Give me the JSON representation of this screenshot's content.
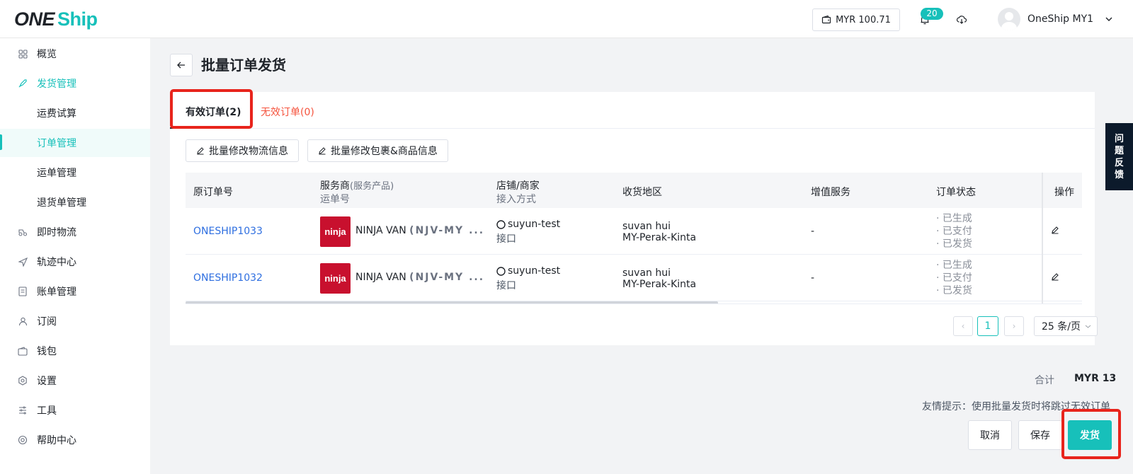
{
  "header": {
    "logo_one": "ONE",
    "logo_ship": "Ship",
    "balance": "MYR 100.71",
    "notification_count": "20",
    "user_name": "OneShip MY1"
  },
  "sidebar": {
    "items": [
      {
        "label": "概览",
        "icon": "grid-icon"
      },
      {
        "label": "发货管理",
        "icon": "rocket-icon"
      },
      {
        "label": "运费试算",
        "icon": ""
      },
      {
        "label": "订单管理",
        "icon": ""
      },
      {
        "label": "运单管理",
        "icon": ""
      },
      {
        "label": "退货单管理",
        "icon": ""
      },
      {
        "label": "即时物流",
        "icon": "delivery-icon"
      },
      {
        "label": "轨迹中心",
        "icon": "navigation-icon"
      },
      {
        "label": "账单管理",
        "icon": "bill-icon"
      },
      {
        "label": "订阅",
        "icon": "user-icon"
      },
      {
        "label": "钱包",
        "icon": "wallet-icon"
      },
      {
        "label": "设置",
        "icon": "settings-icon"
      },
      {
        "label": "工具",
        "icon": "tools-icon"
      },
      {
        "label": "帮助中心",
        "icon": "help-icon"
      }
    ]
  },
  "page": {
    "title": "批量订单发货",
    "tabs": [
      {
        "label": "有效订单(2)"
      },
      {
        "label": "无效订单(0)"
      }
    ],
    "tools": {
      "edit_logistics": "批量修改物流信息",
      "edit_package": "批量修改包裹&商品信息"
    }
  },
  "table": {
    "headers": {
      "order_no": "原订单号",
      "carrier": "服务商",
      "carrier_sub": "(服务产品)",
      "tracking_no": "运单号",
      "store": "店铺/商家",
      "access": "接入方式",
      "region": "收货地区",
      "value_added": "增值服务",
      "status": "订单状态",
      "action": "操作"
    },
    "rows": [
      {
        "order_no": "ONESHIP1033",
        "carrier": "NINJA  VAN",
        "product": "(NJV-MY ...",
        "store": "suyun-test",
        "access": "接口",
        "name": "suvan hui",
        "region": "MY-Perak-Kinta",
        "value_added": "-",
        "status": [
          "· 已生成",
          "· 已支付",
          "· 已发货"
        ]
      },
      {
        "order_no": "ONESHIP1032",
        "carrier": "NINJA  VAN",
        "product": "(NJV-MY ...",
        "store": "suyun-test",
        "access": "接口",
        "name": "suvan hui",
        "region": "MY-Perak-Kinta",
        "value_added": "-",
        "status": [
          "· 已生成",
          "· 已支付",
          "· 已发货"
        ]
      }
    ],
    "carrier_logo_text": "ninja"
  },
  "pagination": {
    "current": "1",
    "page_size": "25 条/页"
  },
  "footer": {
    "total_label": "合计",
    "total_value": "MYR 13",
    "tip": "友情提示：使用批量发货时将跳过无效订单",
    "cancel": "取消",
    "save": "保存",
    "ship": "发货"
  },
  "feedback": {
    "label_chars": [
      "问",
      "题",
      "反",
      "馈"
    ]
  },
  "colors": {
    "brand": "#17c0ba",
    "highlight": "#e8241c",
    "link": "#2f6fe0",
    "error_tab": "#f5533d"
  }
}
